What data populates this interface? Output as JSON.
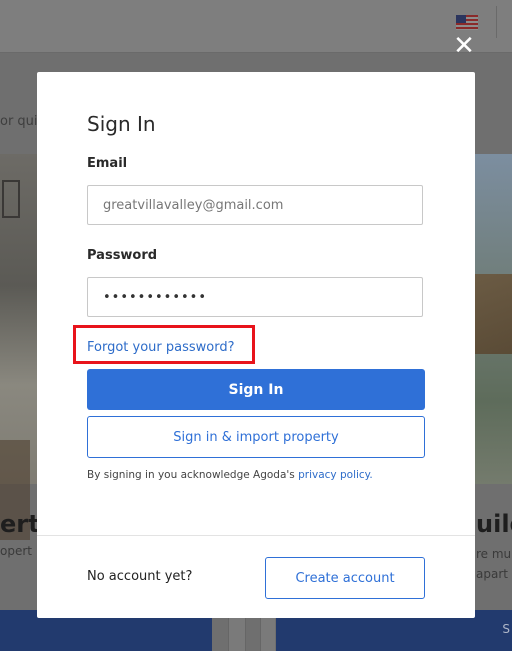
{
  "background": {
    "tagline_fragment": "or qui",
    "left_title_fragment": "erty",
    "left_sub_fragment": "opert",
    "right_title_fragment": "uild",
    "right_sub_line1": "re mu",
    "right_sub_line2": "apart",
    "bottom_right_fragment": "S",
    "flag_icon": "us-flag-icon",
    "close_icon": "close-icon",
    "close_glyph": "✕"
  },
  "signin": {
    "title": "Sign In",
    "email_label": "Email",
    "email_value": "greatvillavalley@gmail.com",
    "password_label": "Password",
    "password_value": "••••••••••••",
    "forgot_link": "Forgot your password?",
    "sign_in_button": "Sign In",
    "import_button": "Sign in & import property",
    "legal_prefix": "By signing in you acknowledge Agoda's ",
    "legal_link": "privacy policy.",
    "no_account": "No account yet?",
    "create_account": "Create account"
  },
  "colors": {
    "primary": "#2f70d7",
    "highlight": "#e8131b",
    "overlay": "#6f6f6f"
  }
}
